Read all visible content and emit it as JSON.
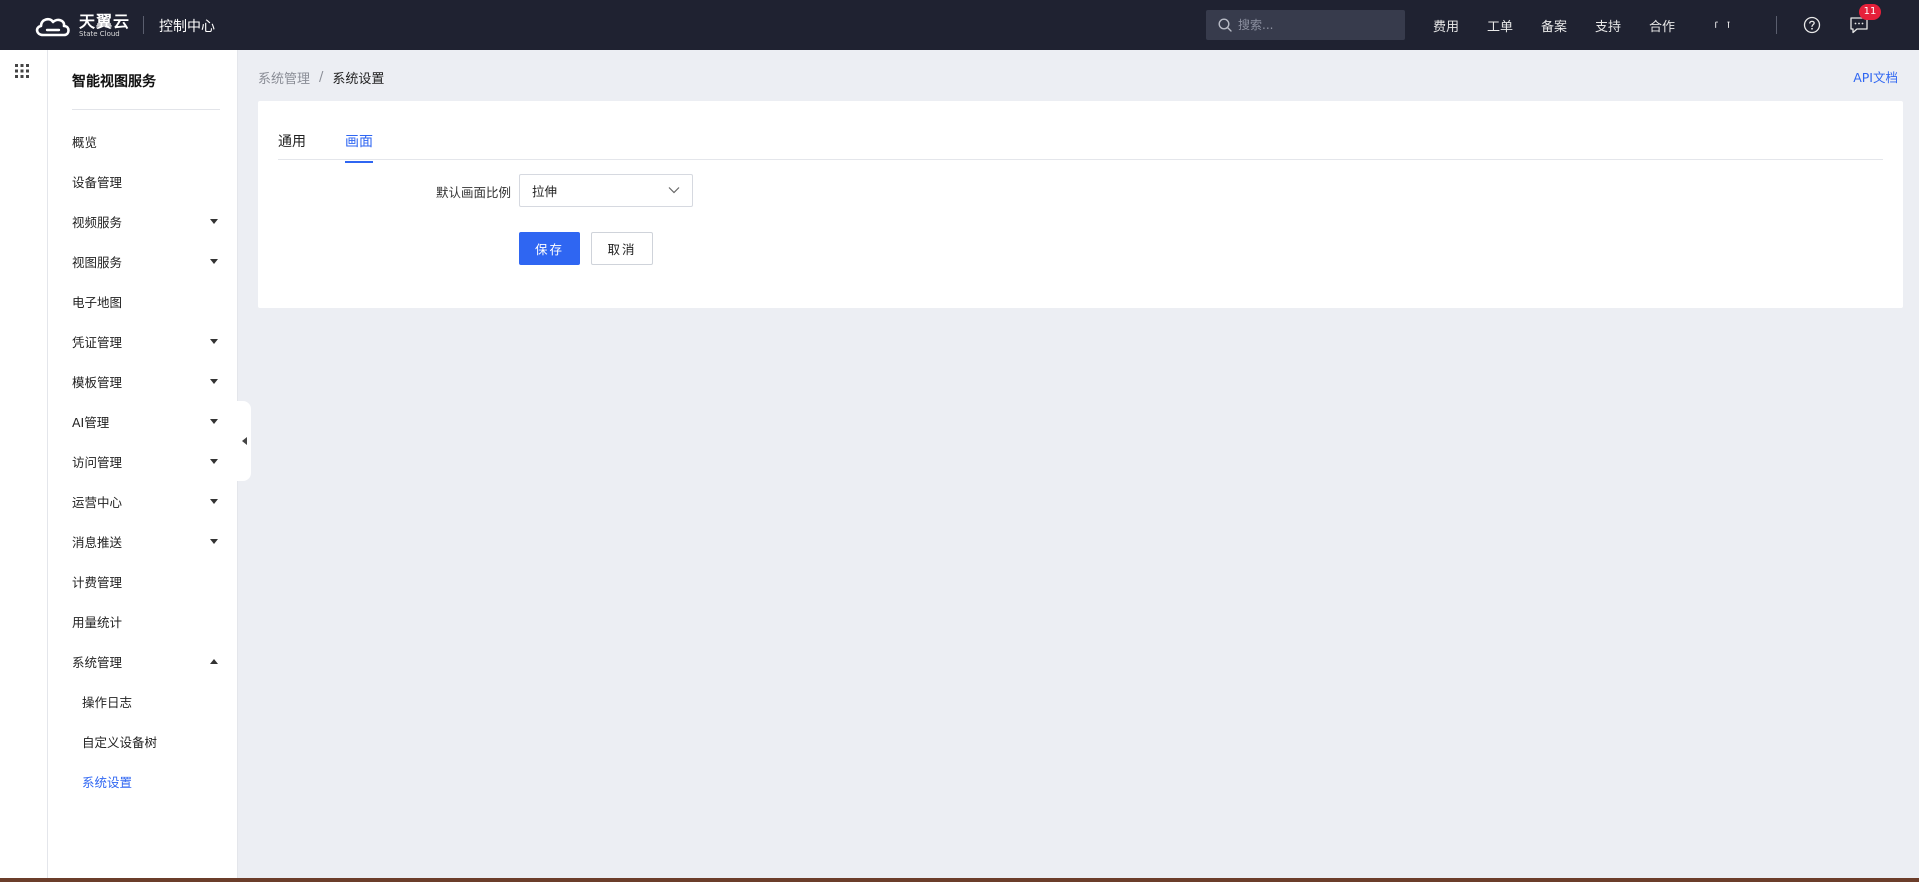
{
  "header": {
    "logo_cn": "天翼云",
    "logo_en": "State Cloud",
    "console_title": "控制中心",
    "search_placeholder": "搜索...",
    "nav": [
      "费用",
      "工单",
      "备案",
      "支持",
      "合作"
    ],
    "notification_count": "11"
  },
  "sidebar": {
    "title": "智能视图服务",
    "items": [
      {
        "label": "概览",
        "expandable": false
      },
      {
        "label": "设备管理",
        "expandable": false
      },
      {
        "label": "视频服务",
        "expandable": true
      },
      {
        "label": "视图服务",
        "expandable": true
      },
      {
        "label": "电子地图",
        "expandable": false
      },
      {
        "label": "凭证管理",
        "expandable": true
      },
      {
        "label": "模板管理",
        "expandable": true
      },
      {
        "label": "AI管理",
        "expandable": true
      },
      {
        "label": "访问管理",
        "expandable": true
      },
      {
        "label": "运营中心",
        "expandable": true
      },
      {
        "label": "消息推送",
        "expandable": true
      },
      {
        "label": "计费管理",
        "expandable": false
      },
      {
        "label": "用量统计",
        "expandable": false
      },
      {
        "label": "系统管理",
        "expandable": true,
        "expanded": true
      }
    ],
    "subitems": [
      {
        "label": "操作日志"
      },
      {
        "label": "自定义设备树"
      },
      {
        "label": "系统设置",
        "active": true
      }
    ]
  },
  "breadcrumb": {
    "parent": "系统管理",
    "separator": "/",
    "current": "系统设置"
  },
  "api_doc_link": "API文档",
  "tabs": [
    {
      "label": "通用",
      "active": false
    },
    {
      "label": "画面",
      "active": true
    }
  ],
  "form": {
    "aspect_label": "默认画面比例",
    "aspect_value": "拉伸",
    "save_label": "保存",
    "cancel_label": "取消"
  },
  "colors": {
    "accent": "#2f66f2",
    "topbar_bg": "#1f2231",
    "badge": "#e6203a",
    "page_bg": "#eceef3"
  }
}
